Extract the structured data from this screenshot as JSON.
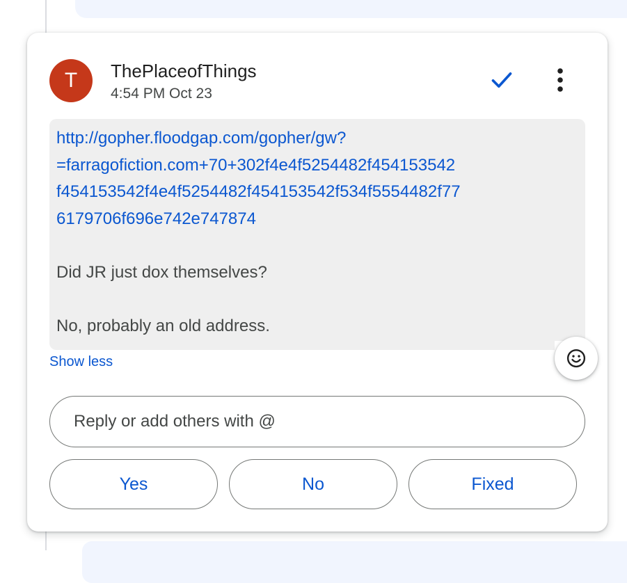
{
  "comment": {
    "author_initial": "T",
    "author_name": "ThePlaceofThings",
    "timestamp": "4:54 PM Oct 23",
    "link_text": "http://gopher.floodgap.com/gopher/gw?\n=farragofiction.com+70+302f4e4f5254482f454153542\nf454153542f4e4f5254482f454153542f534f5554482f77\n6179706f696e742e747874",
    "lines": [
      "Did JR just dox themselves?",
      "No, probably an old address."
    ],
    "show_less_label": "Show less"
  },
  "icons": {
    "resolve": "check-icon",
    "more": "more-vert-icon",
    "emoji": "emoji-smile-icon"
  },
  "reply": {
    "placeholder": "Reply or add others with @",
    "value": ""
  },
  "quick_replies": [
    {
      "label": "Yes"
    },
    {
      "label": "No"
    },
    {
      "label": "Fixed"
    }
  ],
  "colors": {
    "accent": "#0b57d0",
    "avatar": "#c5381a",
    "comment_bg": "#efefef"
  }
}
